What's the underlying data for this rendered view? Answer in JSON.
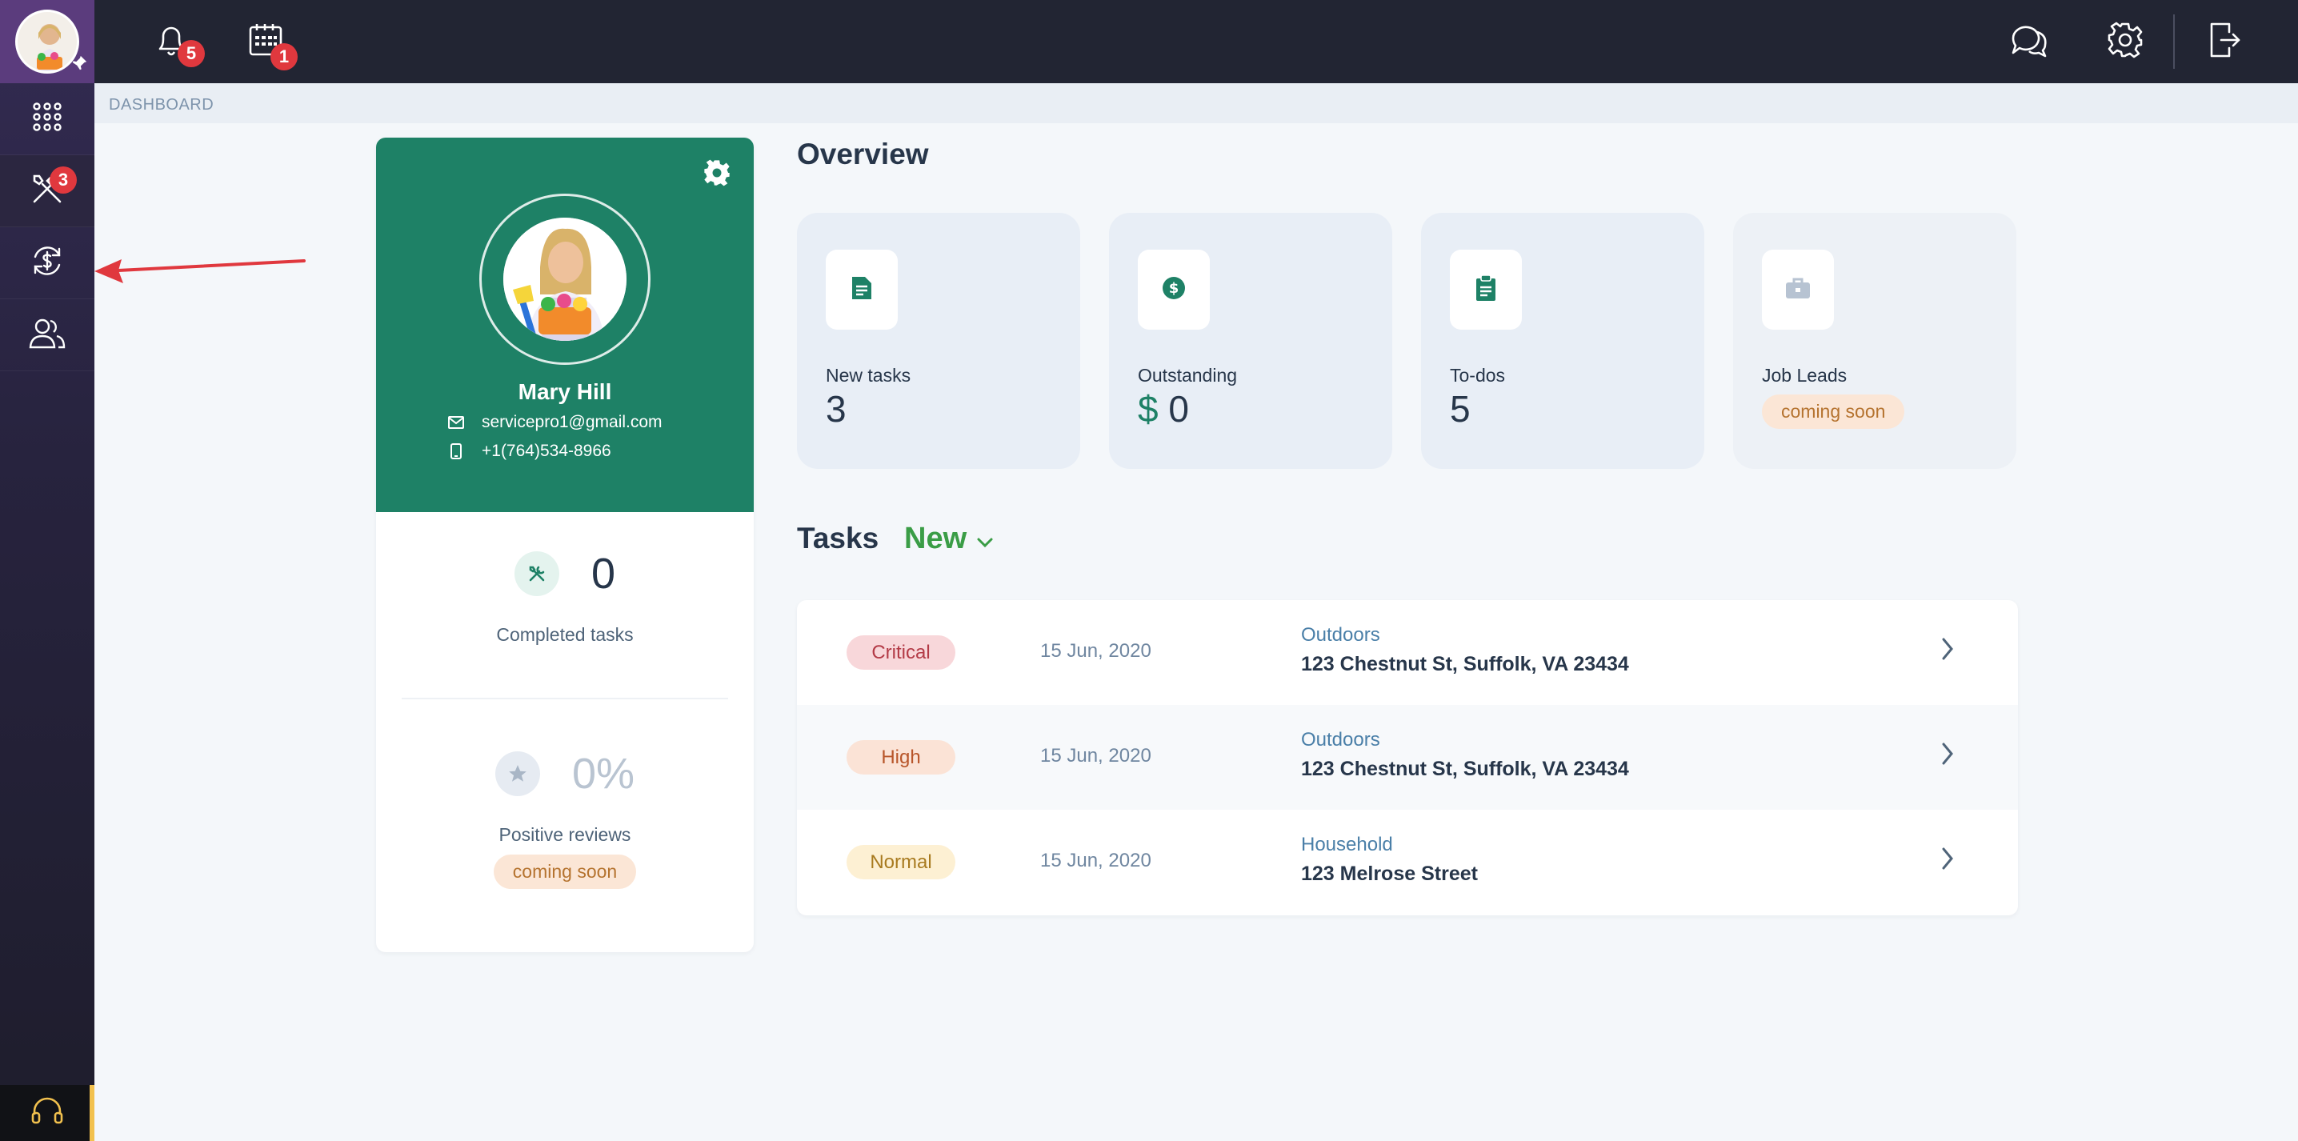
{
  "sidebar": {
    "tools_badge": "3"
  },
  "topbar": {
    "notifications_badge": "5",
    "calendar_badge": "1"
  },
  "breadcrumb": "DASHBOARD",
  "profile": {
    "name": "Mary Hill",
    "email": "servicepro1@gmail.com",
    "phone": "+1(764)534-8966",
    "completed_value": "0",
    "completed_label": "Completed tasks",
    "reviews_value": "0%",
    "reviews_label": "Positive reviews",
    "reviews_pill": "coming soon"
  },
  "overview": {
    "title": "Overview",
    "cards": [
      {
        "label": "New tasks",
        "value": "3"
      },
      {
        "label": "Outstanding",
        "currency": "$",
        "value": "0"
      },
      {
        "label": "To-dos",
        "value": "5"
      },
      {
        "label": "Job Leads",
        "pill": "coming soon"
      }
    ]
  },
  "tasks": {
    "title": "Tasks",
    "filter": "New",
    "rows": [
      {
        "priority": "Critical",
        "date": "15 Jun, 2020",
        "category": "Outdoors",
        "address": "123 Chestnut St, Suffolk, VA 23434"
      },
      {
        "priority": "High",
        "date": "15 Jun, 2020",
        "category": "Outdoors",
        "address": "123 Chestnut St, Suffolk, VA 23434"
      },
      {
        "priority": "Normal",
        "date": "15 Jun, 2020",
        "category": "Household",
        "address": "123 Melrose Street"
      }
    ]
  },
  "colors": {
    "brand_green": "#1e8166",
    "critical_bg": "#f8d7da",
    "critical_fg": "#b33a46",
    "high_bg": "#fbe3d6",
    "high_fg": "#b8562a",
    "normal_bg": "#fdf0d3",
    "normal_fg": "#a87a1f"
  }
}
